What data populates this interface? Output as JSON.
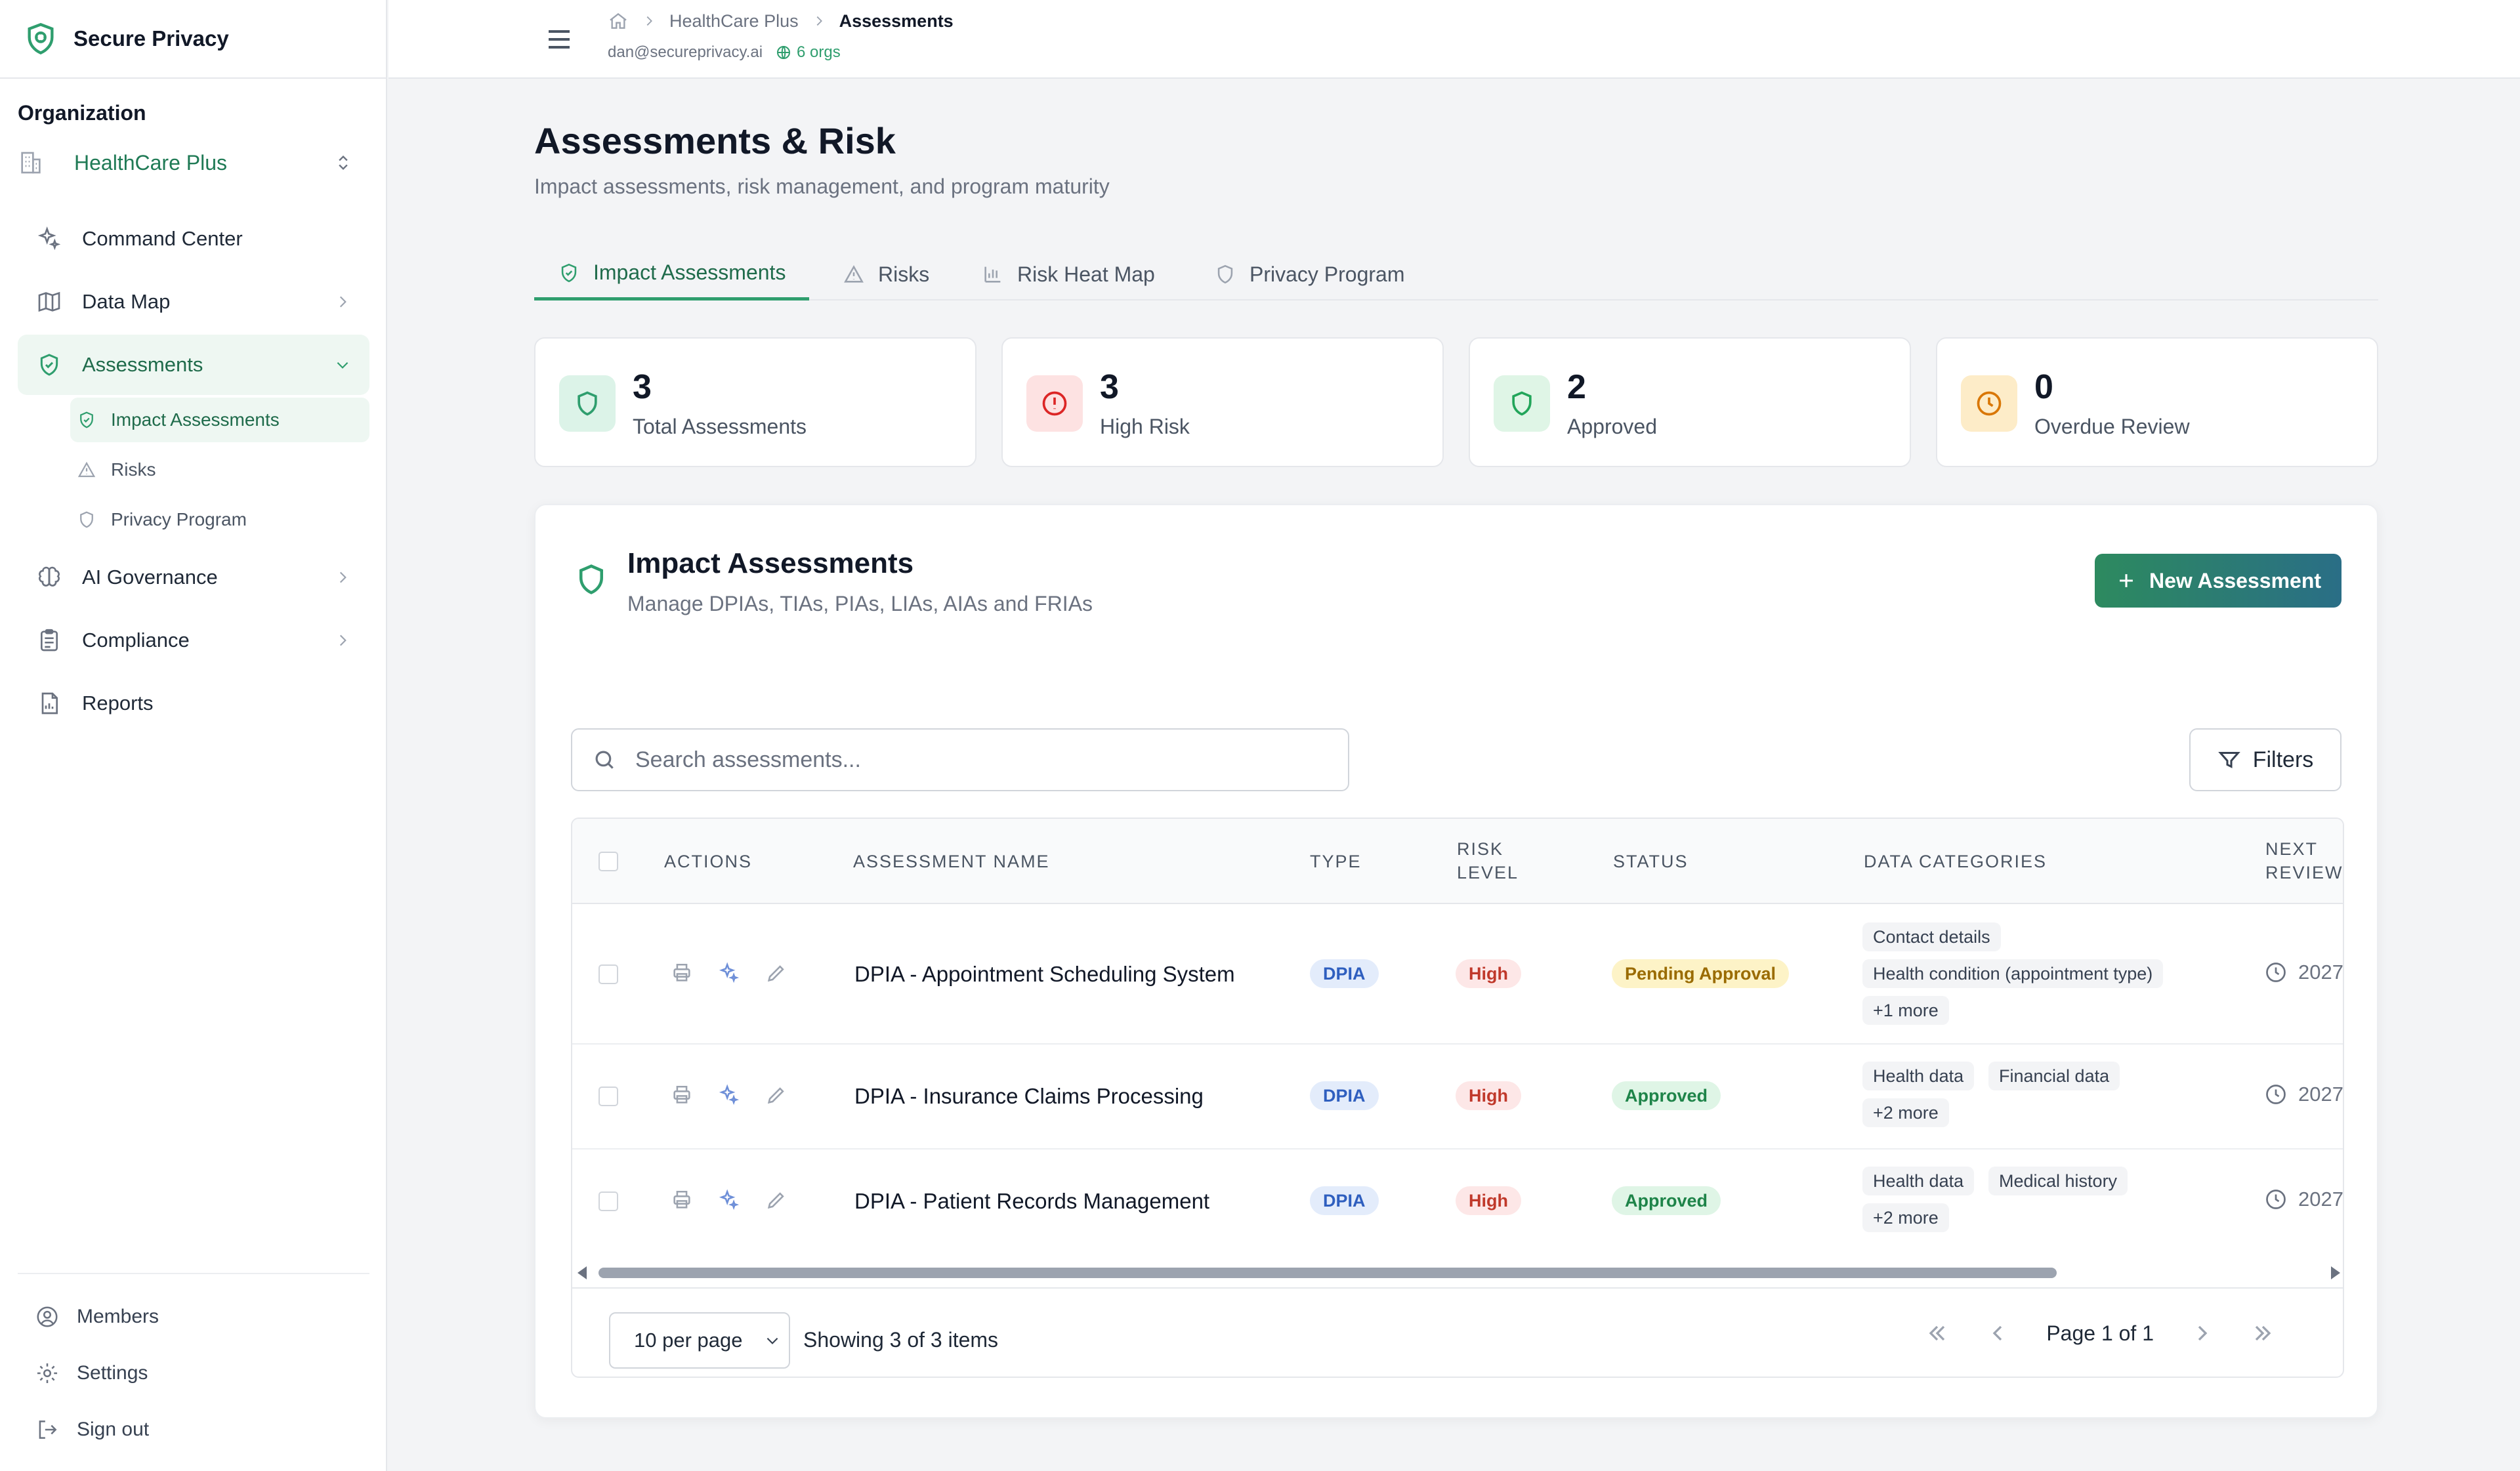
{
  "brand": {
    "name": "Secure Privacy"
  },
  "sidebar": {
    "org_label": "Organization",
    "org_name": "HealthCare Plus",
    "items": [
      {
        "label": "Command Center",
        "icon": "sparkle-icon"
      },
      {
        "label": "Data Map",
        "icon": "map-icon"
      },
      {
        "label": "Assessments",
        "icon": "shield-check-icon"
      },
      {
        "label": "AI Governance",
        "icon": "brain-icon"
      },
      {
        "label": "Compliance",
        "icon": "clipboard-icon"
      },
      {
        "label": "Reports",
        "icon": "report-icon"
      }
    ],
    "sub_items": [
      {
        "label": "Impact Assessments"
      },
      {
        "label": "Risks"
      },
      {
        "label": "Privacy Program"
      }
    ],
    "bottom": [
      {
        "label": "Members"
      },
      {
        "label": "Settings"
      },
      {
        "label": "Sign out"
      }
    ]
  },
  "topbar": {
    "breadcrumb": [
      "HealthCare Plus",
      "Assessments"
    ],
    "email": "dan@secureprivacy.ai",
    "orgs": "6 orgs"
  },
  "page": {
    "title": "Assessments & Risk",
    "subtitle": "Impact assessments, risk management, and program maturity"
  },
  "tabs": [
    {
      "label": "Impact Assessments"
    },
    {
      "label": "Risks"
    },
    {
      "label": "Risk Heat Map"
    },
    {
      "label": "Privacy Program"
    }
  ],
  "stats": [
    {
      "value": "3",
      "label": "Total Assessments",
      "color": "#2f9e6e"
    },
    {
      "value": "3",
      "label": "High Risk",
      "color": "#dc2626"
    },
    {
      "value": "2",
      "label": "Approved",
      "color": "#22a55a"
    },
    {
      "value": "0",
      "label": "Overdue Review",
      "color": "#d97706"
    }
  ],
  "panel": {
    "title": "Impact Assessments",
    "subtitle": "Manage DPIAs, TIAs, PIAs, LIAs, AIAs and FRIAs",
    "new_button": "New Assessment",
    "search_placeholder": "Search assessments...",
    "filters_label": "Filters"
  },
  "table": {
    "headers": {
      "actions": "ACTIONS",
      "name": "ASSESSMENT NAME",
      "type": "TYPE",
      "risk_1": "RISK",
      "risk_2": "LEVEL",
      "status": "STATUS",
      "categories": "DATA CATEGORIES",
      "next_1": "NEXT",
      "next_2": "REVIEW"
    },
    "rows": [
      {
        "name": "DPIA - Appointment Scheduling System",
        "type": "DPIA",
        "risk": "High",
        "status": "Pending Approval",
        "categories": [
          "Contact details",
          "Health condition (appointment type)",
          "+1 more"
        ],
        "next_review": "2027"
      },
      {
        "name": "DPIA - Insurance Claims Processing",
        "type": "DPIA",
        "risk": "High",
        "status": "Approved",
        "categories": [
          "Health data",
          "Financial data",
          "+2 more"
        ],
        "next_review": "2027"
      },
      {
        "name": "DPIA - Patient Records Management",
        "type": "DPIA",
        "risk": "High",
        "status": "Approved",
        "categories": [
          "Health data",
          "Medical history",
          "+2 more"
        ],
        "next_review": "2027"
      }
    ]
  },
  "pagination": {
    "per_page": "10 per page",
    "showing": "Showing 3 of 3 items",
    "page_text": "Page 1 of 1"
  }
}
